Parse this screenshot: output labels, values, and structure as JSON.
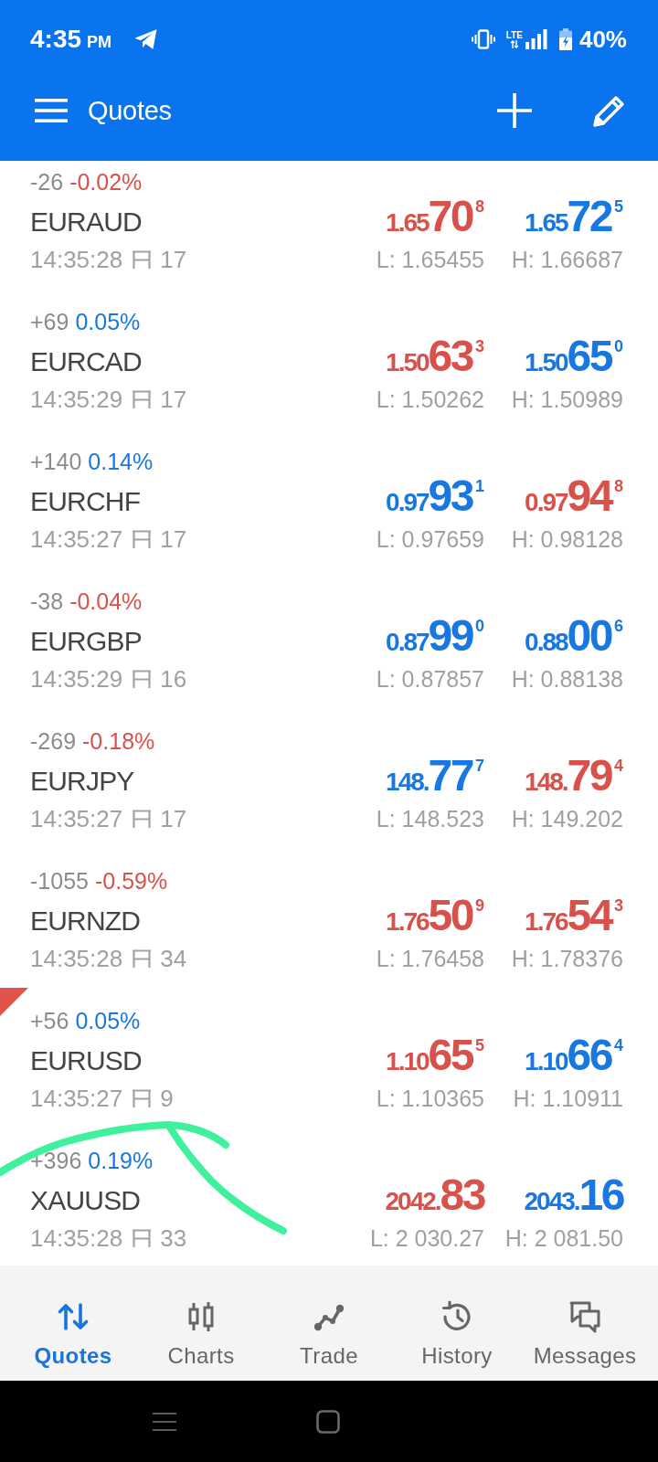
{
  "status_bar": {
    "time": "4:35",
    "period": "PM",
    "network": "LTE",
    "battery": "40%"
  },
  "toolbar": {
    "title": "Quotes"
  },
  "quotes": [
    {
      "change_points": "-26",
      "change_percent": "-0.02%",
      "change_up": false,
      "symbol": "EURAUD",
      "time": "14:35:28",
      "spread": "17",
      "bid": {
        "head": "1.65",
        "big": "70",
        "pip": "8",
        "up": false
      },
      "ask": {
        "head": "1.65",
        "big": "72",
        "pip": "5",
        "up": true
      },
      "low": "L: 1.65455",
      "high": "H: 1.66687",
      "flagged": false
    },
    {
      "change_points": "+69",
      "change_percent": "0.05%",
      "change_up": true,
      "symbol": "EURCAD",
      "time": "14:35:29",
      "spread": "17",
      "bid": {
        "head": "1.50",
        "big": "63",
        "pip": "3",
        "up": false
      },
      "ask": {
        "head": "1.50",
        "big": "65",
        "pip": "0",
        "up": true
      },
      "low": "L: 1.50262",
      "high": "H: 1.50989",
      "flagged": false
    },
    {
      "change_points": "+140",
      "change_percent": "0.14%",
      "change_up": true,
      "symbol": "EURCHF",
      "time": "14:35:27",
      "spread": "17",
      "bid": {
        "head": "0.97",
        "big": "93",
        "pip": "1",
        "up": true
      },
      "ask": {
        "head": "0.97",
        "big": "94",
        "pip": "8",
        "up": false
      },
      "low": "L: 0.97659",
      "high": "H: 0.98128",
      "flagged": false
    },
    {
      "change_points": "-38",
      "change_percent": "-0.04%",
      "change_up": false,
      "symbol": "EURGBP",
      "time": "14:35:29",
      "spread": "16",
      "bid": {
        "head": "0.87",
        "big": "99",
        "pip": "0",
        "up": true
      },
      "ask": {
        "head": "0.88",
        "big": "00",
        "pip": "6",
        "up": true
      },
      "low": "L: 0.87857",
      "high": "H: 0.88138",
      "flagged": false
    },
    {
      "change_points": "-269",
      "change_percent": "-0.18%",
      "change_up": false,
      "symbol": "EURJPY",
      "time": "14:35:27",
      "spread": "17",
      "bid": {
        "head": "148.",
        "big": "77",
        "pip": "7",
        "up": true
      },
      "ask": {
        "head": "148.",
        "big": "79",
        "pip": "4",
        "up": false
      },
      "low": "L: 148.523",
      "high": "H: 149.202",
      "flagged": false
    },
    {
      "change_points": "-1055",
      "change_percent": "-0.59%",
      "change_up": false,
      "symbol": "EURNZD",
      "time": "14:35:28",
      "spread": "34",
      "bid": {
        "head": "1.76",
        "big": "50",
        "pip": "9",
        "up": false
      },
      "ask": {
        "head": "1.76",
        "big": "54",
        "pip": "3",
        "up": false
      },
      "low": "L: 1.76458",
      "high": "H: 1.78376",
      "flagged": false
    },
    {
      "change_points": "+56",
      "change_percent": "0.05%",
      "change_up": true,
      "symbol": "EURUSD",
      "time": "14:35:27",
      "spread": "9",
      "bid": {
        "head": "1.10",
        "big": "65",
        "pip": "5",
        "up": false
      },
      "ask": {
        "head": "1.10",
        "big": "66",
        "pip": "4",
        "up": true
      },
      "low": "L: 1.10365",
      "high": "H: 1.10911",
      "flagged": true
    },
    {
      "change_points": "+396",
      "change_percent": "0.19%",
      "change_up": true,
      "symbol": "XAUUSD",
      "time": "14:35:28",
      "spread": "33",
      "bid": {
        "head": "2042.",
        "big": "83",
        "up": false
      },
      "ask": {
        "head": "2043.",
        "big": "16",
        "up": true
      },
      "low": "L: 2 030.27",
      "high": "H: 2 081.50",
      "flagged": false
    }
  ],
  "bottom_nav": [
    {
      "label": "Quotes",
      "selected": true
    },
    {
      "label": "Charts",
      "selected": false
    },
    {
      "label": "Trade",
      "selected": false
    },
    {
      "label": "History",
      "selected": false
    },
    {
      "label": "Messages",
      "selected": false
    }
  ]
}
